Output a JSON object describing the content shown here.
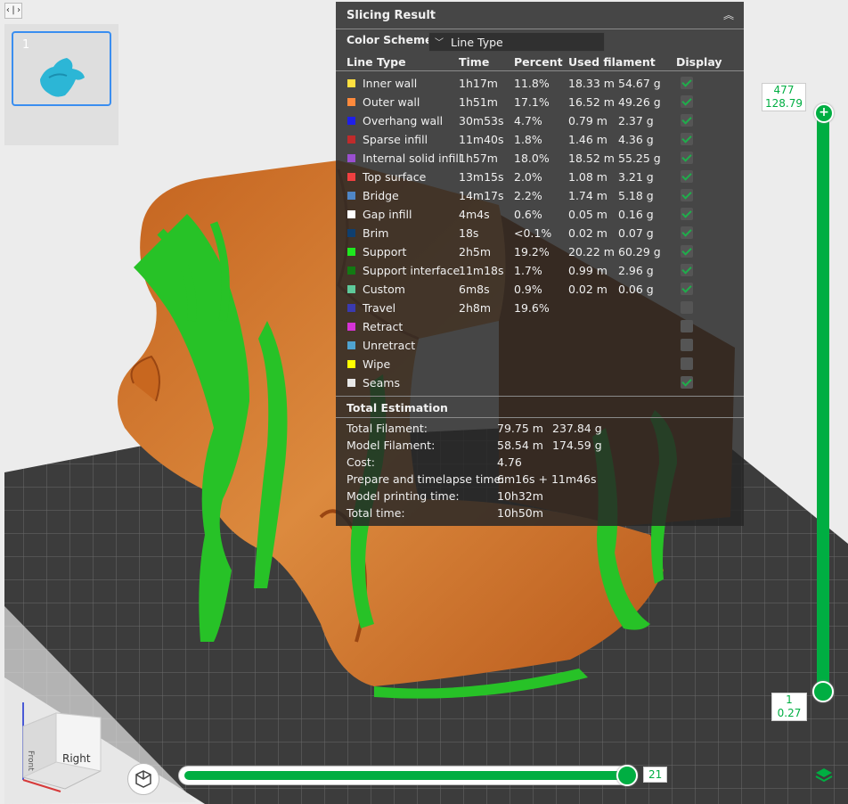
{
  "toggle_glyph": "‹|›",
  "plates": [
    {
      "number": "1"
    }
  ],
  "panel": {
    "title": "Slicing Result",
    "color_scheme_label": "Color Scheme",
    "color_scheme_value": "Line Type",
    "headers": {
      "line_type": "Line Type",
      "time": "Time",
      "percent": "Percent",
      "used_filament": "Used filament",
      "display": "Display"
    },
    "rows": [
      {
        "name": "Inner wall",
        "color": "#ffe040",
        "time": "1h17m",
        "percent": "11.8%",
        "length": "18.33 m",
        "weight": "54.67 g",
        "display": true
      },
      {
        "name": "Outer wall",
        "color": "#ff8a3c",
        "time": "1h51m",
        "percent": "17.1%",
        "length": "16.52 m",
        "weight": "49.26 g",
        "display": true
      },
      {
        "name": "Overhang wall",
        "color": "#1f1fe8",
        "time": "30m53s",
        "percent": "4.7%",
        "length": "0.79 m",
        "weight": "2.37 g",
        "display": true
      },
      {
        "name": "Sparse infill",
        "color": "#c02b2b",
        "time": "11m40s",
        "percent": "1.8%",
        "length": "1.46 m",
        "weight": "4.36 g",
        "display": true
      },
      {
        "name": "Internal solid infill",
        "color": "#9a4fd0",
        "time": "1h57m",
        "percent": "18.0%",
        "length": "18.52 m",
        "weight": "55.25 g",
        "display": true
      },
      {
        "name": "Top surface",
        "color": "#f04040",
        "time": "13m15s",
        "percent": "2.0%",
        "length": "1.08 m",
        "weight": "3.21 g",
        "display": true
      },
      {
        "name": "Bridge",
        "color": "#4f86c6",
        "time": "14m17s",
        "percent": "2.2%",
        "length": "1.74 m",
        "weight": "5.18 g",
        "display": true
      },
      {
        "name": "Gap infill",
        "color": "#ffffff",
        "time": "4m4s",
        "percent": "0.6%",
        "length": "0.05 m",
        "weight": "0.16 g",
        "display": true
      },
      {
        "name": "Brim",
        "color": "#0f3f6f",
        "time": "18s",
        "percent": "<0.1%",
        "length": "0.02 m",
        "weight": "0.07 g",
        "display": true
      },
      {
        "name": "Support",
        "color": "#1fe81f",
        "time": "2h5m",
        "percent": "19.2%",
        "length": "20.22 m",
        "weight": "60.29 g",
        "display": true
      },
      {
        "name": "Support interface",
        "color": "#137a13",
        "time": "11m18s",
        "percent": "1.7%",
        "length": "0.99 m",
        "weight": "2.96 g",
        "display": true
      },
      {
        "name": "Custom",
        "color": "#5ec99a",
        "time": "6m8s",
        "percent": "0.9%",
        "length": "0.02 m",
        "weight": "0.06 g",
        "display": true
      },
      {
        "name": "Travel",
        "color": "#3a3ab0",
        "time": "2h8m",
        "percent": "19.6%",
        "length": "",
        "weight": "",
        "display": false
      },
      {
        "name": "Retract",
        "color": "#d633d6",
        "time": "",
        "percent": "",
        "length": "",
        "weight": "",
        "display": false
      },
      {
        "name": "Unretract",
        "color": "#4fa3d0",
        "time": "",
        "percent": "",
        "length": "",
        "weight": "",
        "display": false
      },
      {
        "name": "Wipe",
        "color": "#ffff00",
        "time": "",
        "percent": "",
        "length": "",
        "weight": "",
        "display": false
      },
      {
        "name": "Seams",
        "color": "#e8e8e8",
        "time": "",
        "percent": "",
        "length": "",
        "weight": "",
        "display": true
      }
    ],
    "estimation_title": "Total Estimation",
    "estimation": [
      {
        "label": "Total Filament:",
        "value": "79.75 m",
        "value2": "237.84 g"
      },
      {
        "label": "Model Filament:",
        "value": "58.54 m",
        "value2": "174.59 g"
      },
      {
        "label": "Cost:",
        "value": "4.76",
        "value2": ""
      },
      {
        "label": "Prepare and timelapse time:",
        "value": "6m16s + 11m46s",
        "value2": ""
      },
      {
        "label": "Model printing time:",
        "value": "10h32m",
        "value2": ""
      },
      {
        "label": "Total time:",
        "value": "10h50m",
        "value2": ""
      }
    ]
  },
  "layer_slider": {
    "top_layer": "477",
    "top_height": "128.79",
    "bottom_layer": "1",
    "bottom_height": "0.27"
  },
  "move_slider": {
    "value": "21"
  },
  "nav_cube": {
    "front": "Front",
    "right": "Right"
  },
  "colors": {
    "accent": "#00ae42",
    "model": "#d2752e",
    "support": "#22c422",
    "bed": "#3a3a3a"
  }
}
